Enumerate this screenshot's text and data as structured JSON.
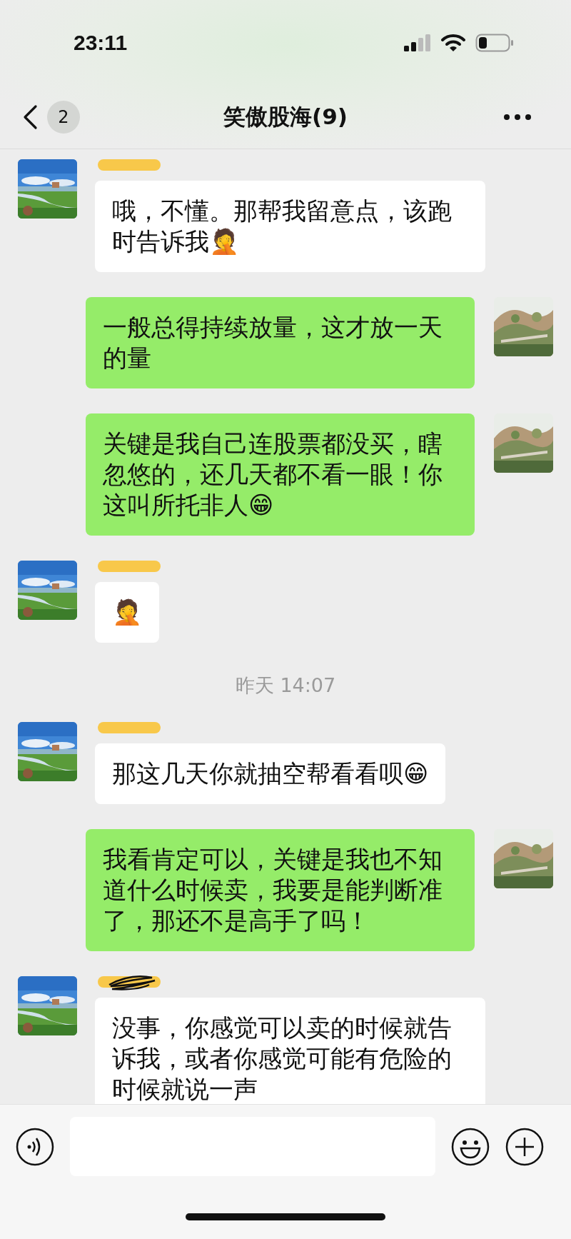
{
  "status_bar": {
    "time": "23:11"
  },
  "header": {
    "back_badge": "2",
    "title": "笑傲股海(9)"
  },
  "messages": [
    {
      "kind": "incoming",
      "name_scribbled": false,
      "text": "哦，不懂。那帮我留意点，该跑时告诉我🤦"
    },
    {
      "kind": "outgoing",
      "text": "一般总得持续放量，这才放一天的量"
    },
    {
      "kind": "outgoing",
      "text": "关键是我自己连股票都没买，瞎忽悠的，还几天都不看一眼！你这叫所托非人😁"
    },
    {
      "kind": "incoming",
      "name_scribbled": false,
      "text": "🤦"
    },
    {
      "kind": "time",
      "text": "昨天 14:07"
    },
    {
      "kind": "incoming",
      "name_scribbled": false,
      "text": "那这几天你就抽空帮看看呗😁"
    },
    {
      "kind": "outgoing",
      "text": "我看肯定可以，关键是我也不知道什么时候卖，我要是能判断准了，那还不是高手了吗！"
    },
    {
      "kind": "incoming",
      "name_scribbled": true,
      "text": "没事，你感觉可以卖的时候就告诉我，或者你感觉可能有危险的时候就说一声"
    }
  ]
}
